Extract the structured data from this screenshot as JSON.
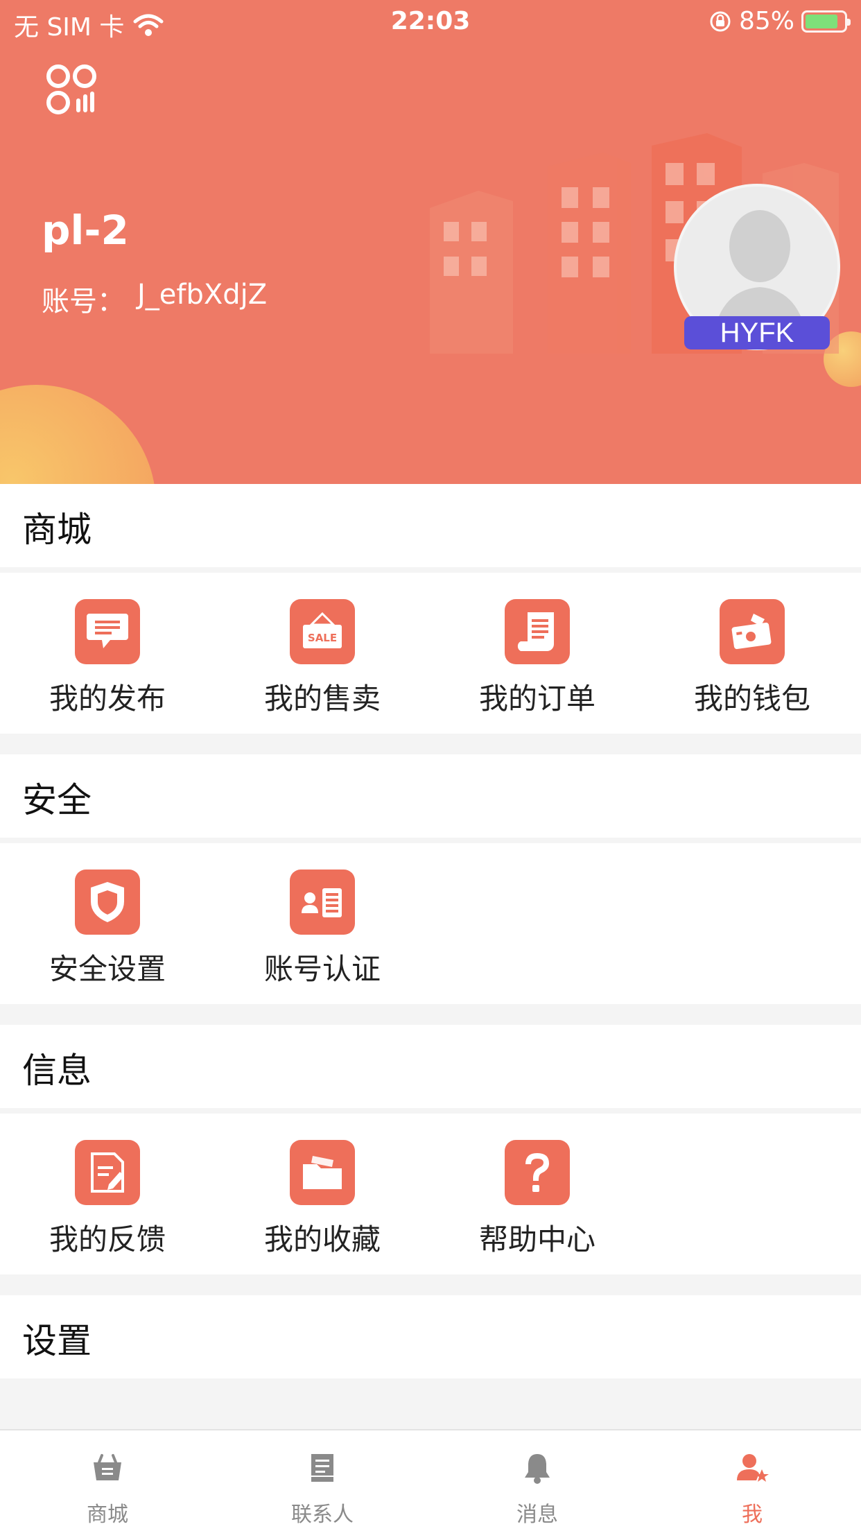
{
  "status_bar": {
    "carrier": "无 SIM 卡",
    "time": "22:03",
    "battery_percent": "85%",
    "battery_level": 0.85
  },
  "profile": {
    "name": "pl-2",
    "account_label": "账号：",
    "account_id": "J_efbXdjZ",
    "avatar_badge": "HYFK"
  },
  "sections": [
    {
      "title": "商城",
      "items": [
        {
          "label": "我的发布",
          "icon": "message-icon"
        },
        {
          "label": "我的售卖",
          "icon": "sale-sign-icon"
        },
        {
          "label": "我的订单",
          "icon": "receipt-icon"
        },
        {
          "label": "我的钱包",
          "icon": "wallet-icon"
        }
      ]
    },
    {
      "title": "安全",
      "items": [
        {
          "label": "安全设置",
          "icon": "shield-icon"
        },
        {
          "label": "账号认证",
          "icon": "id-card-icon"
        }
      ]
    },
    {
      "title": "信息",
      "items": [
        {
          "label": "我的反馈",
          "icon": "feedback-icon"
        },
        {
          "label": "我的收藏",
          "icon": "folder-icon"
        },
        {
          "label": "帮助中心",
          "icon": "question-icon"
        }
      ]
    },
    {
      "title": "设置",
      "items": []
    }
  ],
  "tabbar": {
    "items": [
      {
        "label": "商城",
        "icon": "shop-basket-icon",
        "active": false
      },
      {
        "label": "联系人",
        "icon": "contacts-book-icon",
        "active": false
      },
      {
        "label": "消息",
        "icon": "bell-icon",
        "active": false
      },
      {
        "label": "我",
        "icon": "user-star-icon",
        "active": true
      }
    ]
  },
  "colors": {
    "header_bg": "#ee7a66",
    "accent": "#ee6f5a",
    "badge_bg": "#5b4fd8",
    "tab_inactive": "#8a8a8a"
  }
}
